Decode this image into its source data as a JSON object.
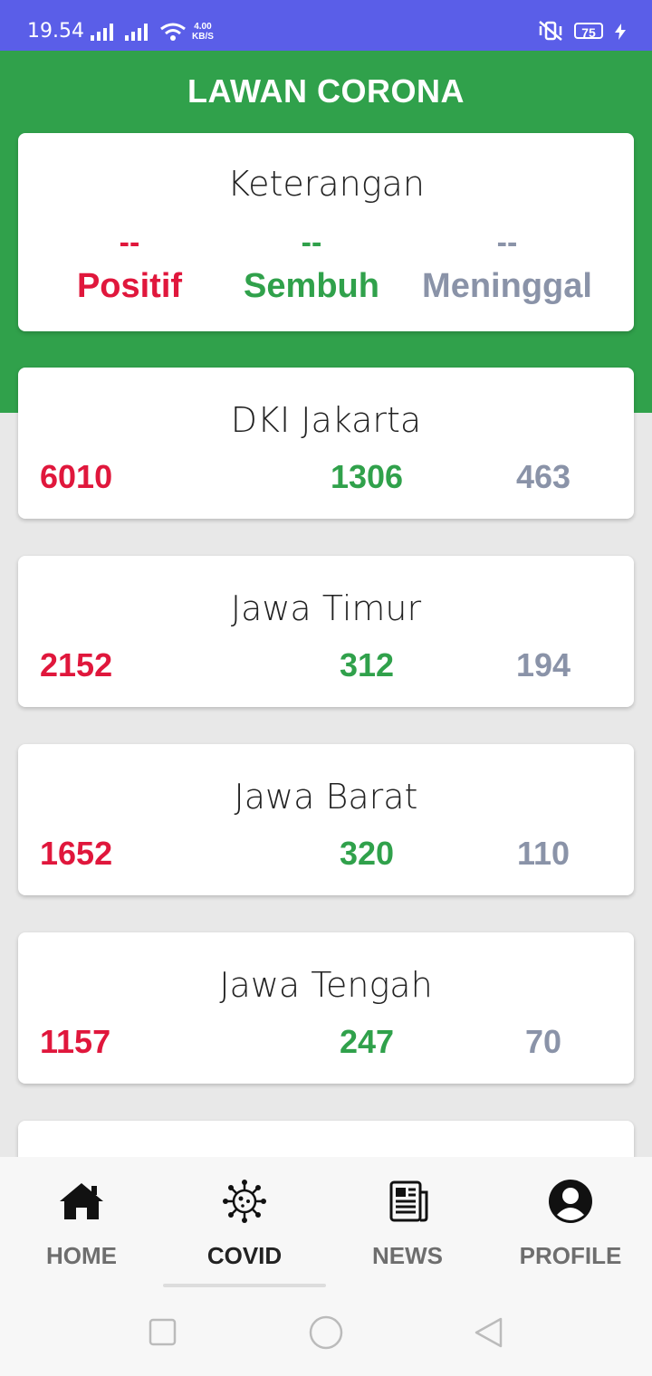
{
  "status_bar": {
    "time": "19.54",
    "net_speed_value": "4.00",
    "net_speed_unit": "KB/S",
    "battery": "75"
  },
  "app": {
    "title": "LAWAN CORONA"
  },
  "legend": {
    "title": "Keterangan",
    "positive": {
      "value": "--",
      "label": "Positif"
    },
    "recovered": {
      "value": "--",
      "label": "Sembuh"
    },
    "deaths": {
      "value": "--",
      "label": "Meninggal"
    }
  },
  "provinces": [
    {
      "name": "DKI Jakarta",
      "positive": "6010",
      "recovered": "1306",
      "deaths": "463"
    },
    {
      "name": "Jawa Timur",
      "positive": "2152",
      "recovered": "312",
      "deaths": "194"
    },
    {
      "name": "Jawa Barat",
      "positive": "1652",
      "recovered": "320",
      "deaths": "110"
    },
    {
      "name": "Jawa Tengah",
      "positive": "1157",
      "recovered": "247",
      "deaths": "70"
    }
  ],
  "nav": {
    "home": "HOME",
    "covid": "COVID",
    "news": "NEWS",
    "profile": "PROFILE",
    "active": "COVID"
  },
  "colors": {
    "positive": "#e0173c",
    "recovered": "#30a14b",
    "deaths": "#8a93a8",
    "header": "#30a14b",
    "status_bar": "#5a5ee8"
  }
}
